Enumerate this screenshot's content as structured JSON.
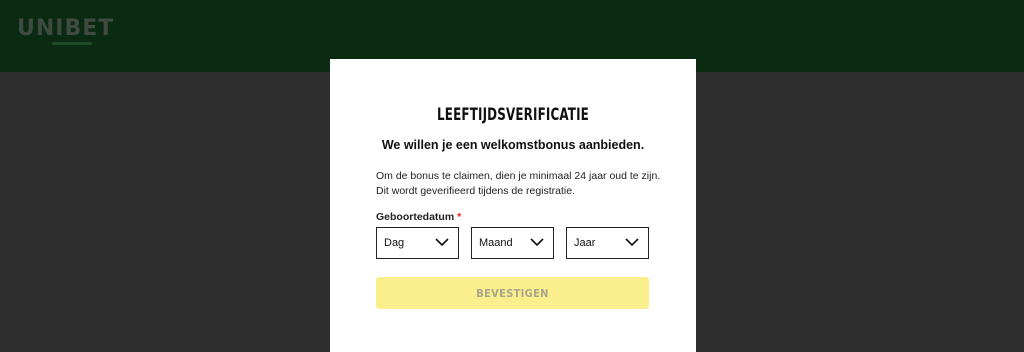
{
  "header": {
    "logo_text": "UNIBET"
  },
  "modal": {
    "title": "LEEFTIJDSVERIFICATIE",
    "subtitle": "We willen je een welkomstbonus aanbieden.",
    "description_line1": "Om de bonus te claimen, dien je minimaal 24 jaar oud te zijn.",
    "description_line2": "Dit wordt geverifieerd tijdens de registratie.",
    "dob_label": "Geboortedatum",
    "required_marker": "*",
    "selects": {
      "day": "Dag",
      "month": "Maand",
      "year": "Jaar"
    },
    "confirm_label": "BEVESTIGEN"
  },
  "colors": {
    "header_bg": "#0a2a12",
    "backdrop": "#2e2e2e",
    "button_bg": "#fbee8c",
    "required": "#e2211c"
  },
  "icons": {
    "select_arrow": "chevron-down-icon"
  }
}
